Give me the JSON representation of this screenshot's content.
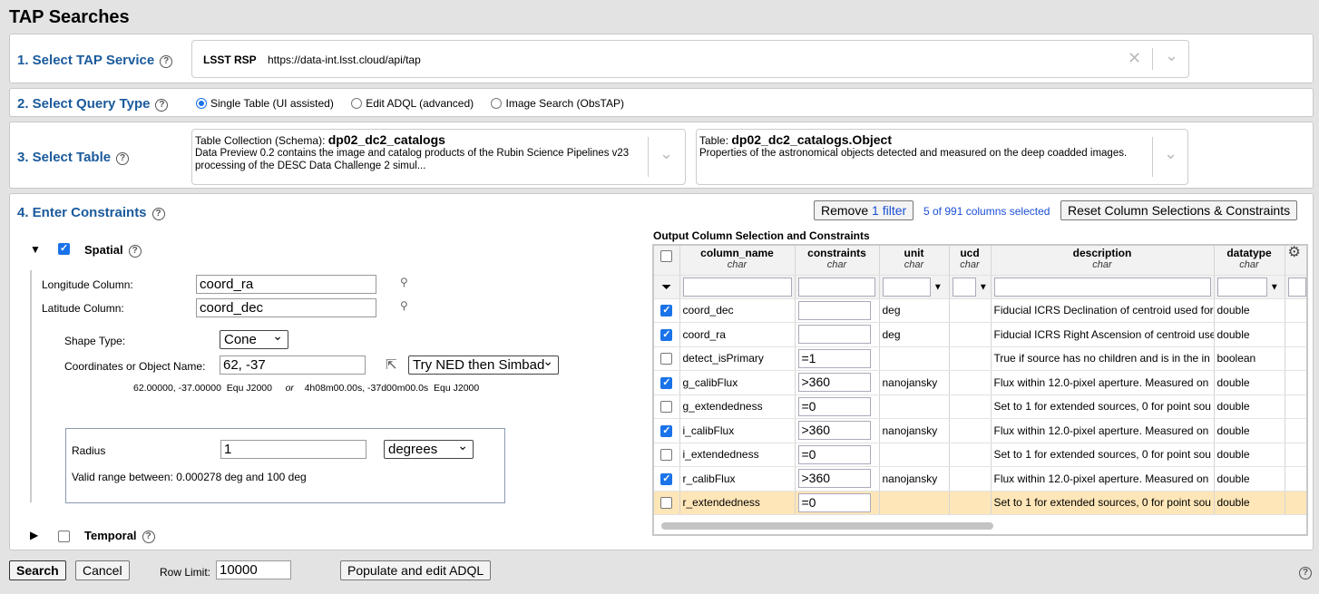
{
  "title": "TAP Searches",
  "s1": {
    "label": "1. Select TAP Service",
    "service_name": "LSST RSP",
    "service_url": "https://data-int.lsst.cloud/api/tap"
  },
  "s2": {
    "label": "2. Select Query Type",
    "options": [
      {
        "label": "Single Table (UI assisted)",
        "selected": true
      },
      {
        "label": "Edit ADQL (advanced)",
        "selected": false
      },
      {
        "label": "Image Search (ObsTAP)",
        "selected": false
      }
    ]
  },
  "s3": {
    "label": "3. Select Table",
    "schema_label": "Table Collection (Schema):",
    "schema": "dp02_dc2_catalogs",
    "schema_desc": "Data Preview 0.2 contains the image and catalog products of the Rubin Science Pipelines v23 processing of the DESC Data Challenge 2 simul...",
    "table_label": "Table:",
    "table": "dp02_dc2_catalogs.Object",
    "table_desc": "Properties of the astronomical objects detected and measured on the deep coadded images."
  },
  "s4": {
    "label": "4. Enter Constraints",
    "remove_filter_prefix": "Remove ",
    "remove_filter_count": "1 filter",
    "columns_selected": "5 of 991 columns selected",
    "reset_label": "Reset Column Selections & Constraints",
    "spatial": {
      "label": "Spatial",
      "checked": true,
      "lon_label": "Longitude Column:",
      "lon": "coord_ra",
      "lat_label": "Latitude Column:",
      "lat": "coord_dec",
      "shape_label": "Shape Type:",
      "shape": "Cone",
      "coord_label": "Coordinates or Object Name:",
      "coord": "62, -37",
      "resolver": "Try NED then Simbad",
      "resolved_dec": "62.00000, -37.00000  Equ J2000",
      "or": "or",
      "resolved_sex": "4h08m00.00s, -37d00m00.0s  Equ J2000",
      "radius_label": "Radius",
      "radius": "1",
      "radius_unit": "degrees",
      "valid_range": "Valid range between: 0.000278 deg and 100 deg"
    },
    "temporal": {
      "label": "Temporal",
      "checked": false
    }
  },
  "table": {
    "title": "Output Column Selection and Constraints",
    "headers": [
      {
        "name": "column_name",
        "type": "char"
      },
      {
        "name": "constraints",
        "type": "char"
      },
      {
        "name": "unit",
        "type": "char"
      },
      {
        "name": "ucd",
        "type": "char"
      },
      {
        "name": "description",
        "type": "char"
      },
      {
        "name": "datatype",
        "type": "char"
      }
    ],
    "rows": [
      {
        "checked": true,
        "name": "coord_dec",
        "constraint": "",
        "unit": "deg",
        "ucd": "",
        "desc": "Fiducial ICRS Declination of centroid used for",
        "dtype": "double"
      },
      {
        "checked": true,
        "name": "coord_ra",
        "constraint": "",
        "unit": "deg",
        "ucd": "",
        "desc": "Fiducial ICRS Right Ascension of centroid use",
        "dtype": "double"
      },
      {
        "checked": false,
        "name": "detect_isPrimary",
        "constraint": "=1",
        "unit": "",
        "ucd": "",
        "desc": "True if source has no children and is in the in",
        "dtype": "boolean"
      },
      {
        "checked": true,
        "name": "g_calibFlux",
        "constraint": ">360",
        "unit": "nanojansky",
        "ucd": "",
        "desc": "Flux within 12.0-pixel aperture. Measured on",
        "dtype": "double"
      },
      {
        "checked": false,
        "name": "g_extendedness",
        "constraint": "=0",
        "unit": "",
        "ucd": "",
        "desc": "Set to 1 for extended sources, 0 for point sou",
        "dtype": "double"
      },
      {
        "checked": true,
        "name": "i_calibFlux",
        "constraint": ">360",
        "unit": "nanojansky",
        "ucd": "",
        "desc": "Flux within 12.0-pixel aperture. Measured on",
        "dtype": "double"
      },
      {
        "checked": false,
        "name": "i_extendedness",
        "constraint": "=0",
        "unit": "",
        "ucd": "",
        "desc": "Set to 1 for extended sources, 0 for point sou",
        "dtype": "double"
      },
      {
        "checked": true,
        "name": "r_calibFlux",
        "constraint": ">360",
        "unit": "nanojansky",
        "ucd": "",
        "desc": "Flux within 12.0-pixel aperture. Measured on",
        "dtype": "double"
      },
      {
        "checked": false,
        "name": "r_extendedness",
        "constraint": "=0",
        "unit": "",
        "ucd": "",
        "desc": "Set to 1 for extended sources, 0 for point sou",
        "dtype": "double",
        "highlighted": true
      }
    ]
  },
  "footer": {
    "search": "Search",
    "cancel": "Cancel",
    "row_limit_label": "Row Limit:",
    "row_limit": "10000",
    "populate": "Populate and edit ADQL"
  },
  "colors": {
    "section": "#1a5a9c",
    "link": "#1a4fd6",
    "highlight": "#ffe6b8",
    "checkbox": "#1a73e8"
  }
}
